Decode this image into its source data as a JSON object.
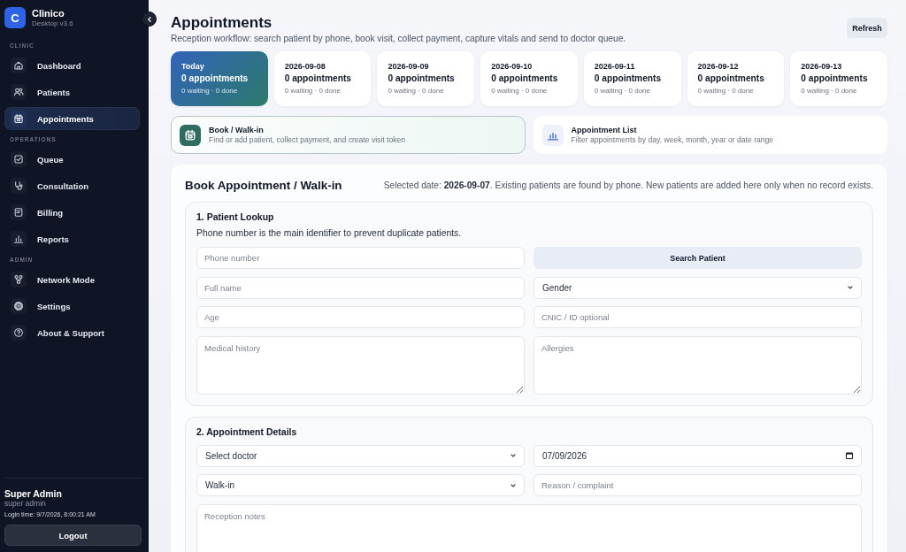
{
  "sidebar": {
    "brand": {
      "logo": "C",
      "name": "Clinico",
      "version": "Desktop v3.6"
    },
    "sections": [
      {
        "label": "CLINIC",
        "items": [
          {
            "label": "Dashboard",
            "selected": false
          },
          {
            "label": "Patients",
            "selected": false
          },
          {
            "label": "Appointments",
            "selected": true
          }
        ]
      },
      {
        "label": "OPERATIONS",
        "items": [
          {
            "label": "Queue",
            "selected": false
          },
          {
            "label": "Consultation",
            "selected": false
          },
          {
            "label": "Billing",
            "selected": false
          },
          {
            "label": "Reports",
            "selected": false
          }
        ]
      },
      {
        "label": "ADMIN",
        "items": [
          {
            "label": "Network Mode",
            "selected": false
          },
          {
            "label": "Settings",
            "selected": false
          },
          {
            "label": "About & Support",
            "selected": false
          }
        ]
      }
    ],
    "user": {
      "name": "Super Admin",
      "role": "super admin",
      "login_time": "Login time: 9/7/2026, 8:00:21 AM"
    },
    "logout": "Logout"
  },
  "header": {
    "title": "Appointments",
    "subtitle": "Reception workflow: search patient by phone, book visit, collect payment, capture vitals and send to doctor queue.",
    "refresh": "Refresh"
  },
  "day_cards": [
    {
      "label": "Today",
      "count": "0 appointments",
      "summary": "0 waiting · 0 done",
      "selected": true
    },
    {
      "label": "2026-09-08",
      "count": "0 appointments",
      "summary": "0 waiting · 0 done",
      "selected": false
    },
    {
      "label": "2026-09-09",
      "count": "0 appointments",
      "summary": "0 waiting · 0 done",
      "selected": false
    },
    {
      "label": "2026-09-10",
      "count": "0 appointments",
      "summary": "0 waiting · 0 done",
      "selected": false
    },
    {
      "label": "2026-09-11",
      "count": "0 appointments",
      "summary": "0 waiting · 0 done",
      "selected": false
    },
    {
      "label": "2026-09-12",
      "count": "0 appointments",
      "summary": "0 waiting · 0 done",
      "selected": false
    },
    {
      "label": "2026-09-13",
      "count": "0 appointments",
      "summary": "0 waiting · 0 done",
      "selected": false
    }
  ],
  "modes": [
    {
      "title": "Book / Walk-in",
      "description": "Find or add patient, collect payment, and create visit token",
      "selected": true
    },
    {
      "title": "Appointment List",
      "description": "Filter appointments by day, week, month, year or date range",
      "selected": false
    }
  ],
  "booking_form": {
    "title": "Book Appointment / Walk-in",
    "note": "Selected date: **2026-09-07**. Existing patients are found by phone. New patients are added here only when no record exists.",
    "sections": [
      {
        "title": "1. Patient Lookup",
        "hint": "Phone number is the main identifier to prevent duplicate patients.",
        "fields": [
          {
            "kind": "input",
            "placeholder": "Phone number"
          },
          {
            "kind": "button",
            "label": "Search Patient"
          },
          {
            "kind": "input",
            "placeholder": "Full name"
          },
          {
            "kind": "select",
            "value": "Gender"
          },
          {
            "kind": "input",
            "placeholder": "Age"
          },
          {
            "kind": "input",
            "placeholder": "CNIC / ID optional"
          },
          {
            "kind": "textarea",
            "placeholder": "Medical history"
          },
          {
            "kind": "textarea",
            "placeholder": "Allergies"
          }
        ]
      },
      {
        "title": "2. Appointment Details",
        "fields": [
          {
            "kind": "select",
            "value": "Select doctor"
          },
          {
            "kind": "date",
            "value": "07/09/2026"
          },
          {
            "kind": "select",
            "value": "Walk-in"
          },
          {
            "kind": "input",
            "placeholder": "Reason / complaint"
          },
          {
            "kind": "textarea",
            "placeholder": "Reception notes",
            "wide": true
          }
        ]
      }
    ]
  }
}
